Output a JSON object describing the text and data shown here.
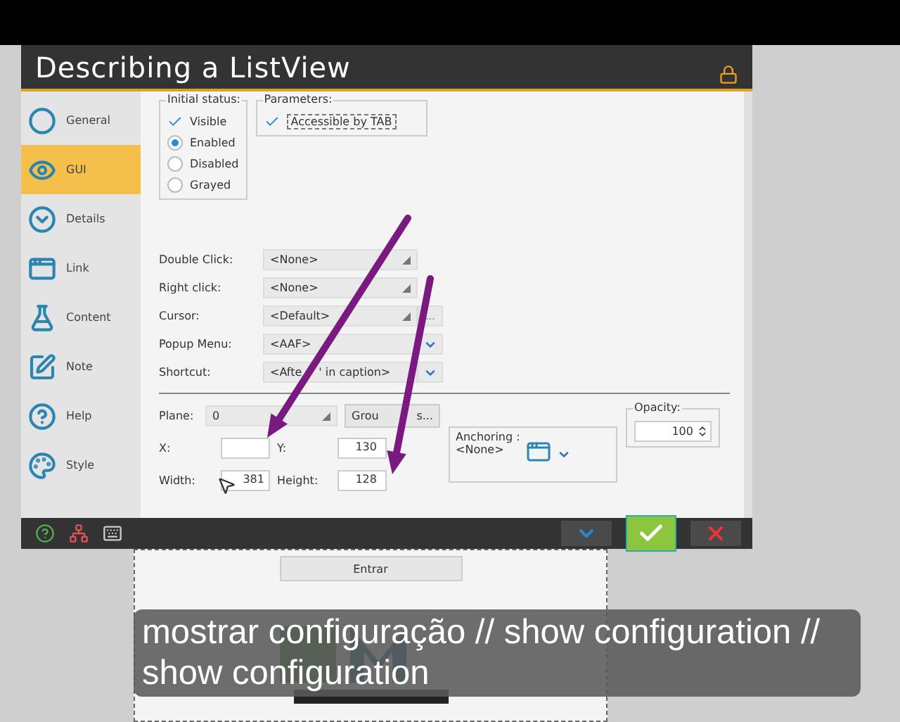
{
  "window": {
    "title": "Describing a ListView"
  },
  "sidebar": {
    "items": [
      {
        "label": "General",
        "selected": false
      },
      {
        "label": "GUI",
        "selected": true
      },
      {
        "label": "Details",
        "selected": false
      },
      {
        "label": "Link",
        "selected": false
      },
      {
        "label": "Content",
        "selected": false
      },
      {
        "label": "Note",
        "selected": false
      },
      {
        "label": "Help",
        "selected": false
      },
      {
        "label": "Style",
        "selected": false
      }
    ]
  },
  "initial_status": {
    "title": "Initial status:",
    "visible": {
      "label": "Visible",
      "checked": true
    },
    "options": [
      {
        "label": "Enabled",
        "selected": true
      },
      {
        "label": "Disabled",
        "selected": false
      },
      {
        "label": "Grayed",
        "selected": false
      }
    ]
  },
  "parameters": {
    "title": "Parameters:",
    "items": [
      {
        "label": "Accessible by TAB",
        "checked": true
      }
    ]
  },
  "events": [
    {
      "label": "Double Click:",
      "value": [
        "<None>"
      ],
      "kind": "plain"
    },
    {
      "label": "Right click:",
      "value": [
        "<None>"
      ],
      "kind": "plain"
    },
    {
      "label": "Cursor:",
      "value": [
        "<Default>"
      ],
      "kind": "more",
      "button": "..."
    },
    {
      "label": "Popup Menu:",
      "value": [
        "<AAF>"
      ],
      "kind": "dropdown"
    },
    {
      "label": "Shortcut:",
      "value": [
        "<Afte",
        "' in caption>"
      ],
      "kind": "dropdown"
    }
  ],
  "plane": {
    "label": "Plane:",
    "value": "0",
    "button": [
      "Grou",
      "s..."
    ]
  },
  "position": {
    "x": {
      "label": "X:"
    },
    "y": {
      "label": "Y:",
      "value": "130"
    },
    "width": {
      "label": "Width:",
      "value": "381"
    },
    "height": {
      "label": "Height:",
      "value": "128"
    }
  },
  "anchoring": {
    "label": "Anchoring :",
    "value": "<None>"
  },
  "opacity": {
    "title": "Opacity:",
    "value": "100"
  },
  "second_window": {
    "button": "Entrar"
  },
  "subtitle": "mostrar configuração // show configuration // show configuration"
}
